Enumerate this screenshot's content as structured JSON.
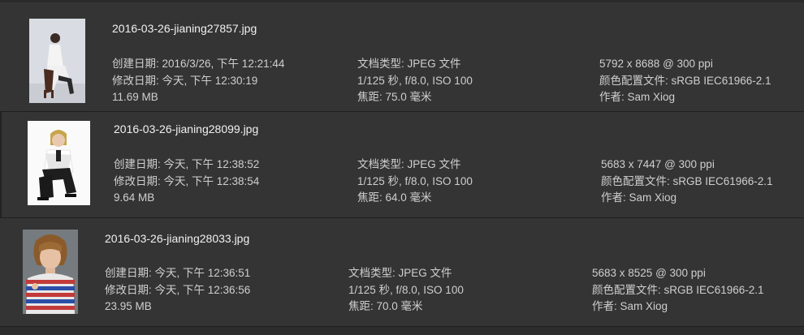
{
  "files": [
    {
      "filename": "2016-03-26-jianing27857.jpg",
      "created": "创建日期: 2016/3/26, 下午 12:21:44",
      "modified": "修改日期: 今天, 下午 12:30:19",
      "size": "11.69 MB",
      "doc_type": "文档类型: JPEG 文件",
      "exposure": "1/125 秒,  f/8.0, ISO 100",
      "focal": "焦距: 75.0 毫米",
      "dimensions": "5792 x 8688 @ 300 ppi",
      "color_profile": "颜色配置文件: sRGB IEC61966-2.1",
      "author": "作者: Sam Xiog"
    },
    {
      "filename": "2016-03-26-jianing28099.jpg",
      "created": "创建日期: 今天, 下午 12:38:52",
      "modified": "修改日期: 今天, 下午 12:38:54",
      "size": "9.64 MB",
      "doc_type": "文档类型: JPEG 文件",
      "exposure": "1/125 秒,  f/8.0, ISO 100",
      "focal": "焦距: 64.0 毫米",
      "dimensions": "5683 x 7447 @ 300 ppi",
      "color_profile": "颜色配置文件: sRGB IEC61966-2.1",
      "author": "作者: Sam Xiog"
    },
    {
      "filename": "2016-03-26-jianing28033.jpg",
      "created": "创建日期: 今天, 下午 12:36:51",
      "modified": "修改日期: 今天, 下午 12:36:56",
      "size": "23.95 MB",
      "doc_type": "文档类型: JPEG 文件",
      "exposure": "1/125 秒,  f/8.0, ISO 100",
      "focal": "焦距: 70.0 毫米",
      "dimensions": "5683 x 8525 @ 300 ppi",
      "color_profile": "颜色配置文件: sRGB IEC61966-2.1",
      "author": "作者: Sam Xiog"
    }
  ]
}
